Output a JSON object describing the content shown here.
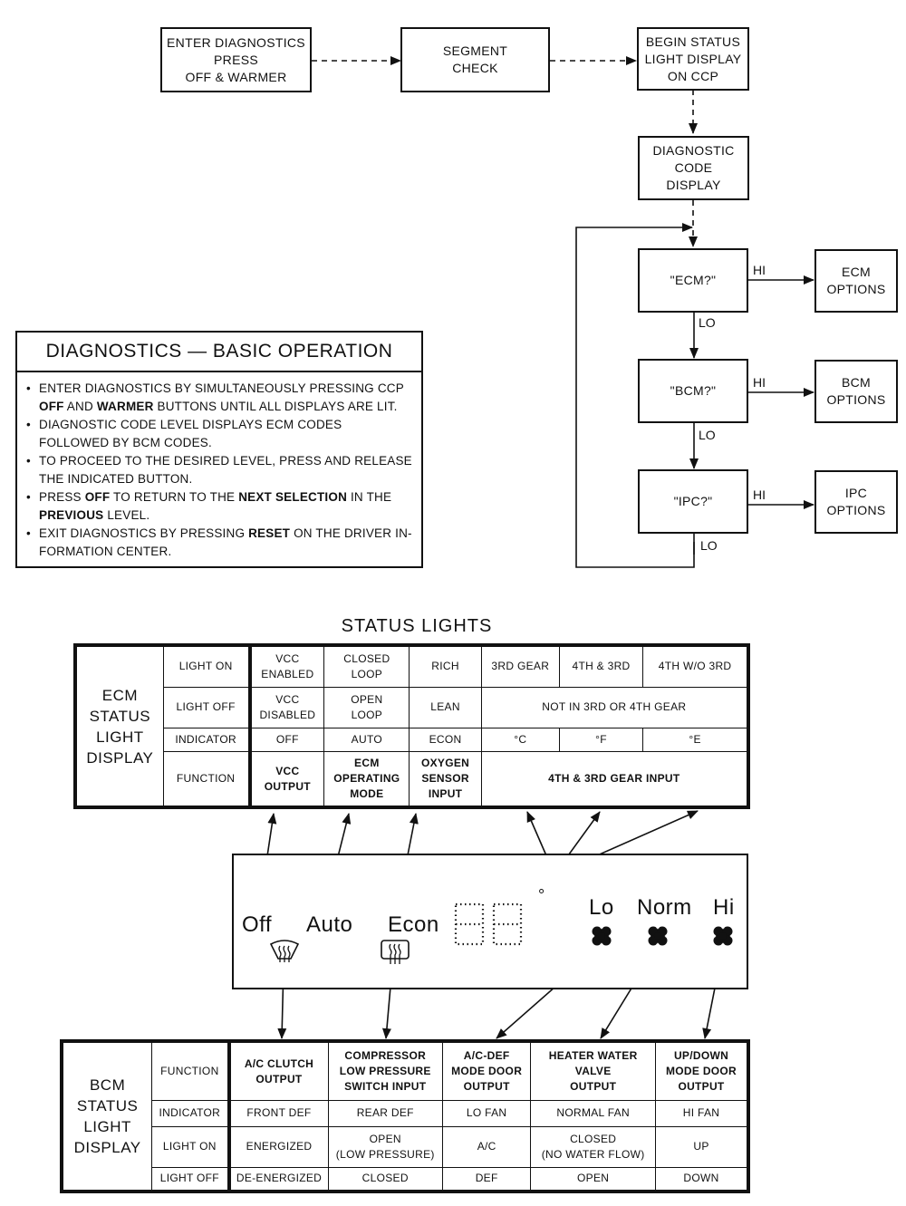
{
  "flowchart": {
    "enter": "ENTER DIAGNOSTICS\nPRESS\nOFF & WARMER",
    "segment": "SEGMENT\nCHECK",
    "begin_status": "BEGIN STATUS\nLIGHT DISPLAY\nON CCP",
    "code_display": "DIAGNOSTIC\nCODE\nDISPLAY",
    "ecm_q": "\"ECM?\"",
    "bcm_q": "\"BCM?\"",
    "ipc_q": "\"IPC?\"",
    "ecm_options": "ECM\nOPTIONS",
    "bcm_options": "BCM\nOPTIONS",
    "ipc_options": "IPC\nOPTIONS",
    "hi": "HI",
    "lo": "LO"
  },
  "basic_operation": {
    "title": "DIAGNOSTICS — BASIC OPERATION",
    "items": [
      [
        {
          "t": "ENTER DIAGNOSTICS BY SIMULTANEOUSLY PRESSING CCP "
        },
        {
          "t": "OFF",
          "b": true
        },
        {
          "t": " AND "
        },
        {
          "t": "WARMER",
          "b": true
        },
        {
          "t": " BUTTONS UNTIL ALL DISPLAYS ARE LIT."
        }
      ],
      [
        {
          "t": "DIAGNOSTIC CODE LEVEL DISPLAYS ECM CODES FOLLOWED BY BCM CODES."
        }
      ],
      [
        {
          "t": "TO PROCEED TO THE DESIRED LEVEL, PRESS AND RELEASE THE INDICATED BUTTON."
        }
      ],
      [
        {
          "t": "PRESS "
        },
        {
          "t": "OFF",
          "b": true
        },
        {
          "t": " TO RETURN TO THE "
        },
        {
          "t": "NEXT SELECTION",
          "b": true
        },
        {
          "t": " IN THE "
        },
        {
          "t": "PREVIOUS",
          "b": true
        },
        {
          "t": " LEVEL."
        }
      ],
      [
        {
          "t": "EXIT DIAGNOSTICS BY PRESSING "
        },
        {
          "t": "RESET",
          "b": true
        },
        {
          "t": " ON THE DRIVER IN-FORMATION CENTER."
        }
      ]
    ]
  },
  "status_lights_title": "STATUS LIGHTS",
  "ecm_table": {
    "header": "ECM\nSTATUS\nLIGHT\nDISPLAY",
    "row_labels": [
      "LIGHT ON",
      "LIGHT OFF",
      "INDICATOR",
      "FUNCTION"
    ],
    "light_on": [
      "VCC\nENABLED",
      "CLOSED\nLOOP",
      "RICH",
      "3RD GEAR",
      "4TH & 3RD",
      "4TH W/O 3RD"
    ],
    "light_off": [
      "VCC\nDISABLED",
      "OPEN\nLOOP",
      "LEAN",
      "NOT IN 3RD OR 4TH GEAR"
    ],
    "indicator": [
      "OFF",
      "AUTO",
      "ECON",
      "°C",
      "°F",
      "°E"
    ],
    "function": [
      "VCC\nOUTPUT",
      "ECM\nOPERATING\nMODE",
      "OXYGEN\nSENSOR\nINPUT",
      "4TH & 3RD GEAR INPUT"
    ]
  },
  "panel": {
    "off": "Off",
    "auto": "Auto",
    "econ": "Econ",
    "degree": "°",
    "lo": "Lo",
    "norm": "Norm",
    "hi": "Hi",
    "icons": [
      "front-defrost-icon",
      "rear-defrost-icon",
      "fan-icon"
    ]
  },
  "bcm_table": {
    "header": "BCM\nSTATUS\nLIGHT\nDISPLAY",
    "row_labels": [
      "FUNCTION",
      "INDICATOR",
      "LIGHT ON",
      "LIGHT OFF"
    ],
    "function": [
      "A/C CLUTCH\nOUTPUT",
      "COMPRESSOR\nLOW PRESSURE\nSWITCH INPUT",
      "A/C-DEF\nMODE DOOR\nOUTPUT",
      "HEATER WATER\nVALVE\nOUTPUT",
      "UP/DOWN\nMODE DOOR\nOUTPUT"
    ],
    "indicator": [
      "FRONT DEF",
      "REAR DEF",
      "LO FAN",
      "NORMAL FAN",
      "HI FAN"
    ],
    "light_on": [
      "ENERGIZED",
      "OPEN\n(LOW PRESSURE)",
      "A/C",
      "CLOSED\n(NO WATER FLOW)",
      "UP"
    ],
    "light_off": [
      "DE-ENERGIZED",
      "CLOSED",
      "DEF",
      "OPEN",
      "DOWN"
    ]
  }
}
